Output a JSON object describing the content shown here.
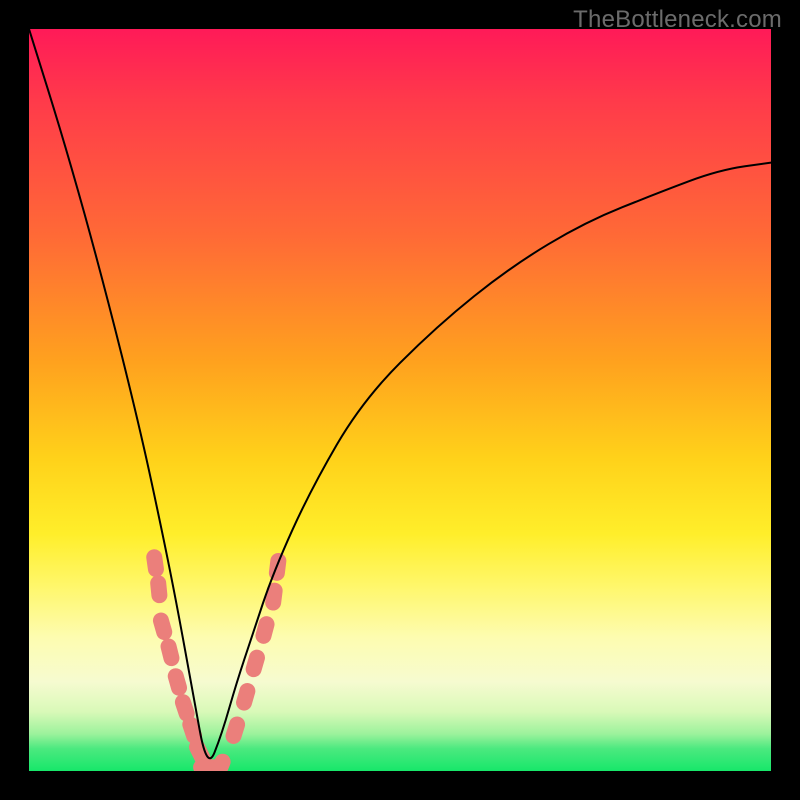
{
  "watermark": "TheBottleneck.com",
  "colors": {
    "frame": "#000000",
    "blob": "#eb7f7b",
    "curve": "#000000",
    "gradient_stops": [
      "#ff1a58",
      "#ff3b4a",
      "#ff6a36",
      "#ffa21e",
      "#ffd21a",
      "#ffee2a",
      "#fff76a",
      "#fdfcb0",
      "#f6fbd0",
      "#d9f9b8",
      "#9cf29c",
      "#4be97f",
      "#17e76a"
    ]
  },
  "chart_data": {
    "type": "line",
    "title": "",
    "xlabel": "",
    "ylabel": "",
    "xlim": [
      0,
      1
    ],
    "ylim": [
      0,
      1
    ],
    "note": "Axes are unlabeled in the source image; coordinates are normalized 0–1 within the plot area. The curve is a V/check shape: steep descent from top-left to a minimum near x≈0.24 (y≈0), then a concave rise toward the right edge reaching y≈0.82 at x=1.",
    "series": [
      {
        "name": "bottleneck-curve",
        "x": [
          0.0,
          0.05,
          0.1,
          0.15,
          0.18,
          0.2,
          0.22,
          0.24,
          0.26,
          0.28,
          0.3,
          0.33,
          0.38,
          0.45,
          0.55,
          0.65,
          0.75,
          0.85,
          0.93,
          1.0
        ],
        "values": [
          1.0,
          0.84,
          0.66,
          0.46,
          0.32,
          0.22,
          0.11,
          0.0,
          0.05,
          0.12,
          0.18,
          0.27,
          0.38,
          0.5,
          0.6,
          0.68,
          0.74,
          0.78,
          0.81,
          0.82
        ]
      }
    ],
    "markers": {
      "name": "highlight-blobs",
      "description": "Rounded pink capsule markers clustered around the minimum of the curve.",
      "points": [
        {
          "x": 0.17,
          "y": 0.28
        },
        {
          "x": 0.175,
          "y": 0.245
        },
        {
          "x": 0.18,
          "y": 0.195
        },
        {
          "x": 0.19,
          "y": 0.16
        },
        {
          "x": 0.2,
          "y": 0.12
        },
        {
          "x": 0.21,
          "y": 0.085
        },
        {
          "x": 0.22,
          "y": 0.055
        },
        {
          "x": 0.23,
          "y": 0.025
        },
        {
          "x": 0.24,
          "y": 0.005
        },
        {
          "x": 0.258,
          "y": 0.005
        },
        {
          "x": 0.278,
          "y": 0.055
        },
        {
          "x": 0.292,
          "y": 0.1
        },
        {
          "x": 0.305,
          "y": 0.145
        },
        {
          "x": 0.318,
          "y": 0.19
        },
        {
          "x": 0.33,
          "y": 0.235
        },
        {
          "x": 0.335,
          "y": 0.275
        }
      ]
    }
  }
}
